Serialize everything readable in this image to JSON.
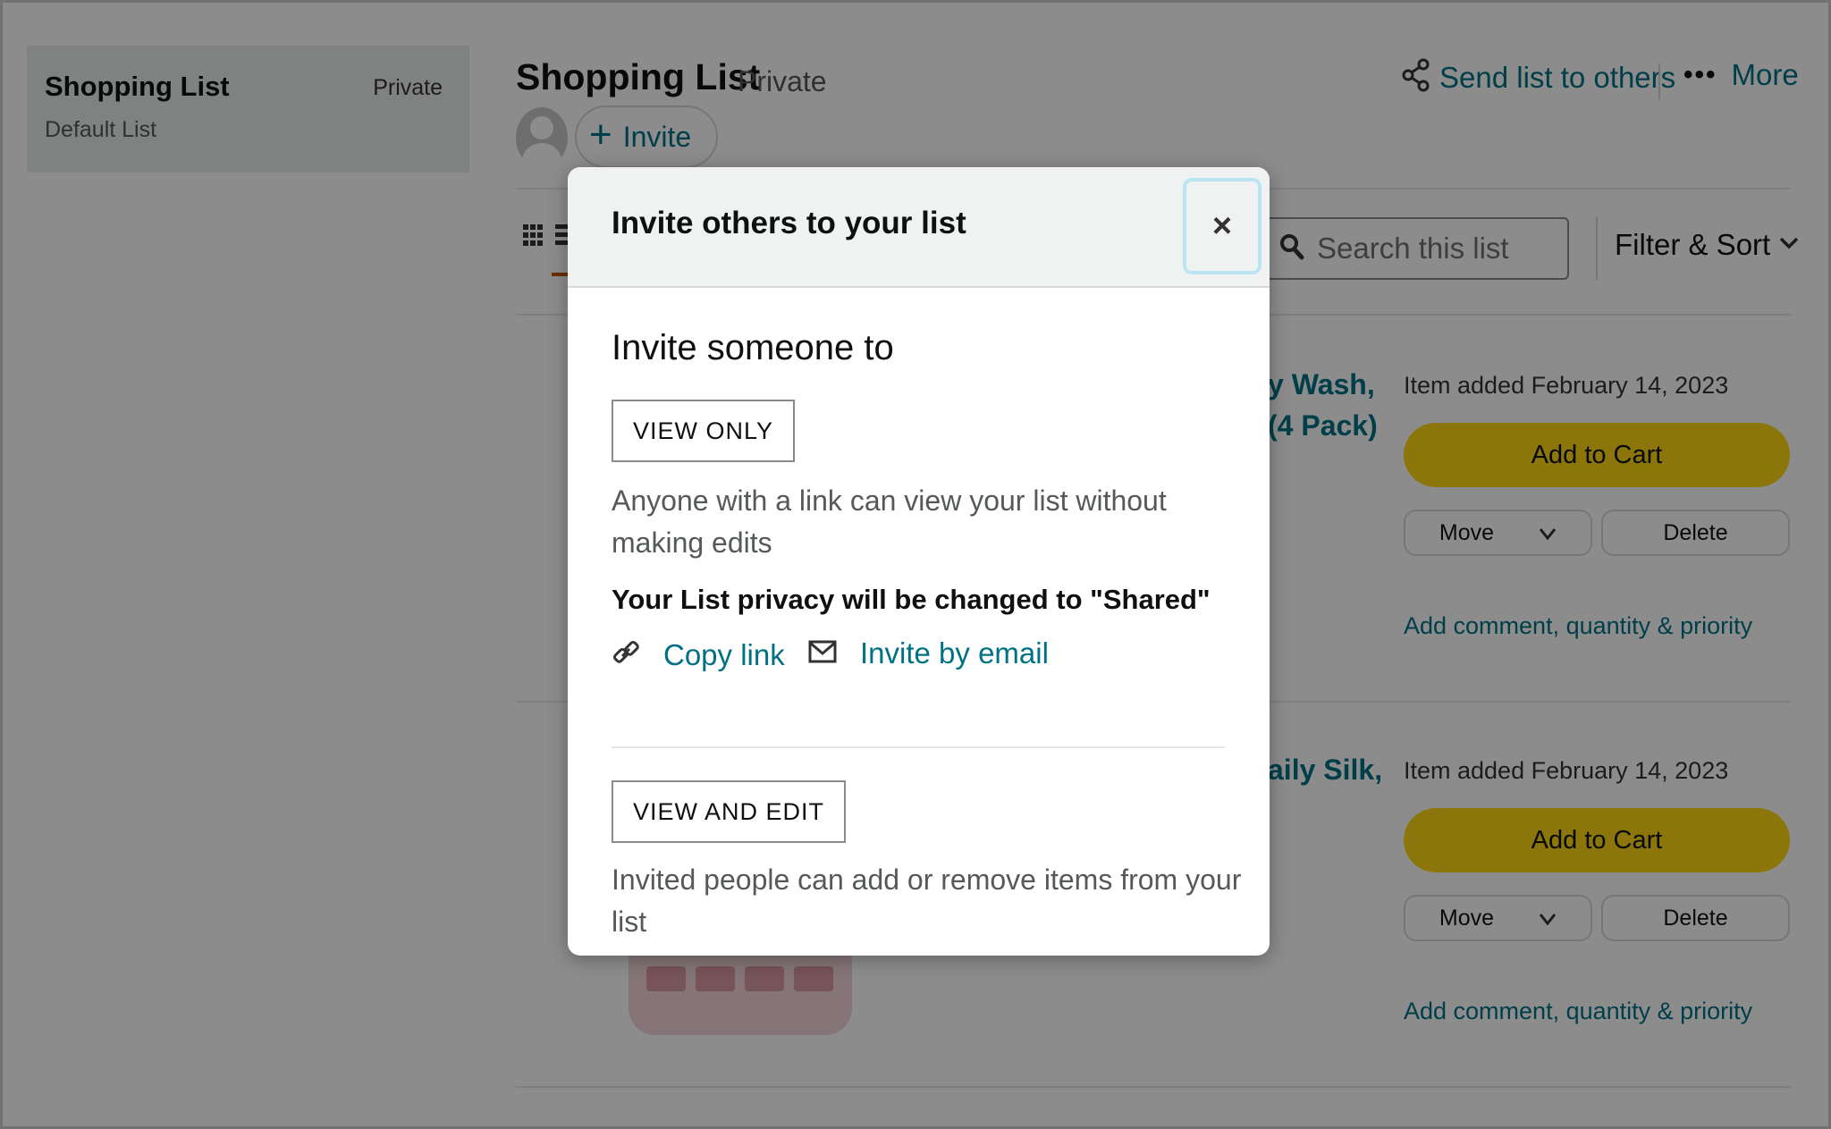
{
  "sidebar": {
    "list_name": "Shopping List",
    "privacy": "Private",
    "subtitle": "Default List"
  },
  "header": {
    "title": "Shopping List",
    "privacy": "Private",
    "invite_label": "Invite",
    "send_label": "Send list to others",
    "more_label": "More"
  },
  "toolbar": {
    "search_placeholder": "Search this list",
    "filter_label": "Filter & Sort"
  },
  "items": [
    {
      "title_line1": "y Wash,",
      "title_line2": "(4 Pack)",
      "date": "Item added February 14, 2023",
      "add_to_cart": "Add to Cart",
      "move": "Move",
      "delete": "Delete",
      "comment": "Add comment, quantity & priority"
    },
    {
      "title_line1": "aily Silk,",
      "date": "Item added February 14, 2023",
      "add_to_cart": "Add to Cart",
      "move": "Move",
      "delete": "Delete",
      "comment": "Add comment, quantity & priority"
    }
  ],
  "modal": {
    "title": "Invite others to your list",
    "close": "×",
    "heading": "Invite someone to",
    "view_only_label": "VIEW ONLY",
    "view_only_desc": "Anyone with a link can view your list without making edits",
    "notice": "Your List privacy will be changed to \"Shared\"",
    "copy_link": "Copy link",
    "invite_email": "Invite by email",
    "view_edit_label": "VIEW AND EDIT",
    "view_edit_desc": "Invited people can add or remove items from your list"
  },
  "colors": {
    "link": "#007185",
    "cart_button": "#ffd814",
    "overlay": "rgba(0,0,0,0.45)"
  },
  "icons": [
    "share-icon",
    "more-dots-icon",
    "plus-icon",
    "avatar-icon",
    "grid-view-icon",
    "list-view-icon",
    "search-icon",
    "chevron-down-icon",
    "close-icon",
    "link-icon",
    "mail-icon"
  ]
}
